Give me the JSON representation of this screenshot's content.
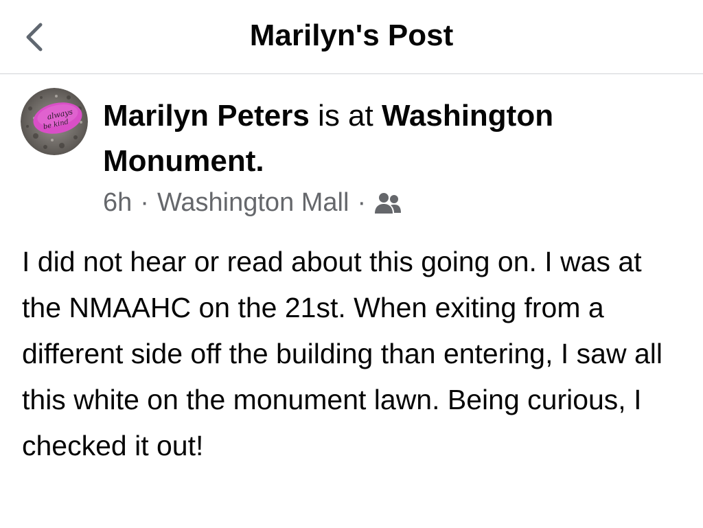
{
  "nav": {
    "title": "Marilyn's Post"
  },
  "post": {
    "author": "Marilyn Peters",
    "connector": "is at",
    "location_line1": "Washington",
    "location_line2": "Monument.",
    "time": "6h",
    "separator": "·",
    "place": "Washington Mall",
    "audience_icon": "friends-icon",
    "avatar_text_1": "always",
    "avatar_text_2": "be kind",
    "body": "I did not hear or read about this going on. I was at the NMAAHC on the 21st. When exiting from a different side off the building than entering, I saw all this white on the monument lawn. Being curious, I checked it out!"
  },
  "colors": {
    "secondary_text": "#65676b",
    "primary_text": "#050505",
    "divider": "#d0d2d6",
    "avatar_rock": "#d94fc7"
  }
}
